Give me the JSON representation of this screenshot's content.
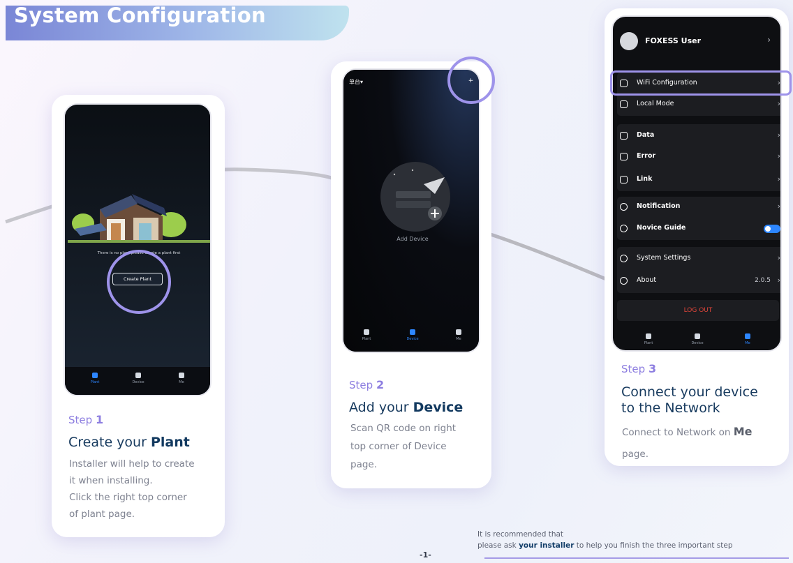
{
  "header": {
    "title": "System Configuration"
  },
  "step1": {
    "label": "Step",
    "number": "1",
    "heading_prefix": "Create your ",
    "heading_bold": "Plant",
    "desc_lines": [
      "Installer will help to create",
      "it when installing.",
      "Click the right top corner",
      "of plant page."
    ],
    "phone": {
      "empty_message": "There is no plant please create a plant first",
      "create_button": "Create Plant",
      "nav": [
        "Plant",
        "Device",
        "Me"
      ]
    }
  },
  "step2": {
    "label": "Step",
    "number": "2",
    "heading_prefix": "Add your ",
    "heading_bold": "Device",
    "desc_lines": [
      "Scan QR code on right",
      "top corner of Device",
      "page."
    ],
    "phone": {
      "selector": "单台▾",
      "add_label": "Add Device",
      "nav": [
        "Plant",
        "Device",
        "Me"
      ]
    }
  },
  "step3": {
    "label": "Step",
    "number": "3",
    "heading_line1": "Connect your device",
    "heading_line2": "to the Network",
    "desc_prefix": "Connect to Network on ",
    "desc_bold": "Me",
    "desc_line2": "page.",
    "phone": {
      "user_name": "FOXESS User",
      "menu": {
        "wifi": "WiFi Configuration",
        "local": "Local Mode",
        "data": "Data",
        "error": "Error",
        "link": "Link",
        "notification": "Notification",
        "novice": "Novice Guide",
        "system": "System Settings",
        "about": "About",
        "version": "2.0.5"
      },
      "logout": "LOG OUT",
      "nav": [
        "Plant",
        "Device",
        "Me"
      ]
    }
  },
  "footer": {
    "line1": "It is recommended that",
    "line2_prefix": "please ask ",
    "line2_bold": "your installer",
    "line2_suffix": " to help you finish the three important step",
    "page_number": "-1-"
  },
  "colors": {
    "accent": "#9e93ea",
    "heading": "#173a5e",
    "toggle": "#2d86ff",
    "logout": "#e0453a"
  }
}
